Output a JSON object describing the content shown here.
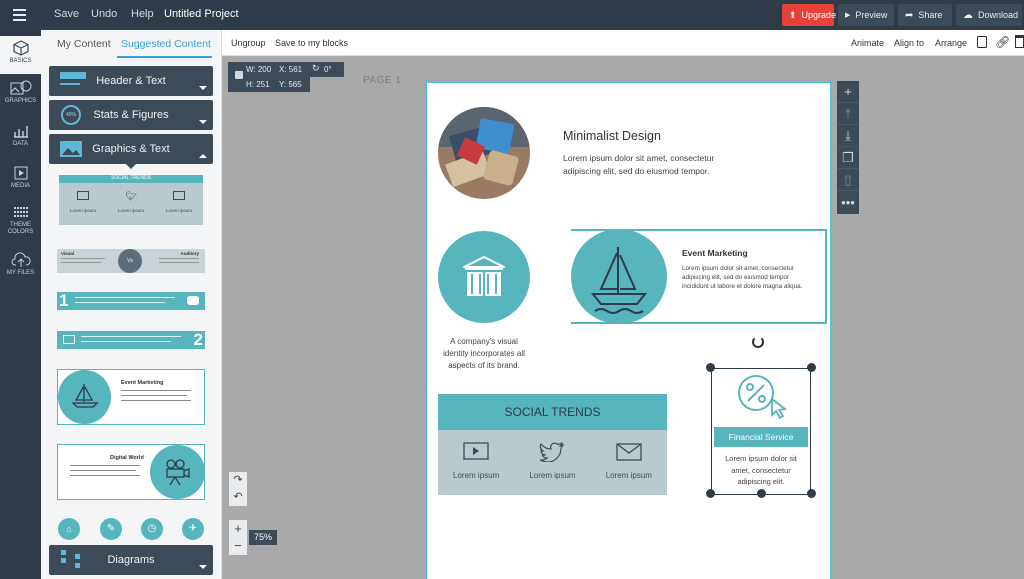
{
  "topbar": {
    "menu": [
      "Save",
      "Undo",
      "Help"
    ],
    "project_title": "Untitled Project",
    "upgrade_label": "Upgrade",
    "preview_label": "Preview",
    "share_label": "Share",
    "download_label": "Download",
    "accent": "#e8413a"
  },
  "rail": {
    "items": [
      "BASICS",
      "GRAPHICS",
      "DATA",
      "MEDIA",
      "THEME COLORS",
      "MY FILES"
    ],
    "icons": [
      "cube-icon",
      "graphics-icon",
      "chart-icon",
      "media-icon",
      "palette-icon",
      "cloud-upload-icon"
    ]
  },
  "panel": {
    "tabs": [
      "My Content",
      "Suggested Content"
    ],
    "accordions": [
      "Header & Text",
      "Stats & Figures",
      "Graphics & Text",
      "Diagrams"
    ],
    "thumb_social_title": "SOCIAL TRENDS",
    "thumb_social_items": [
      "Lorem ipsum",
      "Lorem ipsum",
      "Lorem ipsum"
    ],
    "thumb_visual": [
      "Visual",
      "Vs",
      "Auditory"
    ],
    "thumb_num1": "1",
    "thumb_num2": "2",
    "thumb_event": "Event Marketing",
    "thumb_digital": "Digital World"
  },
  "toolbar2": {
    "left": [
      "Ungroup",
      "Save to my blocks"
    ],
    "right": [
      "Animate",
      "Align to",
      "Arrange"
    ]
  },
  "dims": {
    "w": "W: 200",
    "x": "X: 561",
    "rot": "0°",
    "h": "H: 251",
    "y": "Y: 565"
  },
  "page_label": "PAGE 1",
  "zoom": "75%",
  "canvas": {
    "minimal_title": "Minimalist Design",
    "minimal_body": "Lorem ipsum dolor sit amet, consectetur adipiscing elit, sed do eiusmod tempor.",
    "event_title": "Event Marketing",
    "event_body": "Lorem ipsum dolor sit amet, consectetur adipiscing elit, sed do eiusmod tempor incididunt ut labore et dolore magna aliqua.",
    "visual_caption": "A company's visual identity incorporates all aspects of its brand.",
    "social_title": "SOCIAL TRENDS",
    "social_items": [
      "Lorem ipsum",
      "Lorem ipsum",
      "Lorem ipsum"
    ],
    "financial_title": "Financial Service",
    "financial_body": "Lorem ipsum dolor sit amet, consectetur adipiscing elit.",
    "teal": "#57b5bd"
  }
}
